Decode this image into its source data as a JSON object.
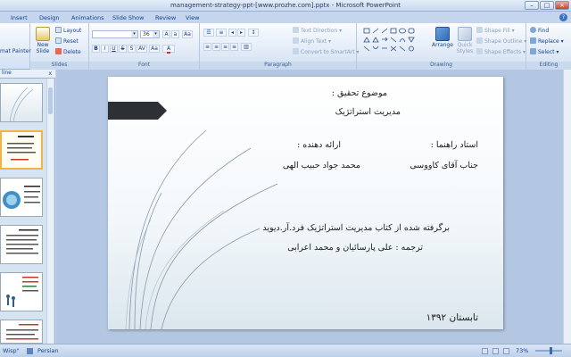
{
  "window": {
    "title": "management-strategy-ppt-[www.prozhe.com].pptx - Microsoft PowerPoint",
    "min": "–",
    "max": "□",
    "close": "×"
  },
  "tabs": [
    {
      "label": "Insert"
    },
    {
      "label": "Design"
    },
    {
      "label": "Animations"
    },
    {
      "label": "Slide Show"
    },
    {
      "label": "Review"
    },
    {
      "label": "View"
    }
  ],
  "ribbon": {
    "clipboard": {
      "paste_painter": "mat Painter"
    },
    "slides": {
      "label": "Slides",
      "new_slide": "New\nSlide",
      "layout": "Layout",
      "reset": "Reset",
      "delete": "Delete"
    },
    "font": {
      "label": "Font",
      "font_size": "36",
      "clear": "Aa"
    },
    "paragraph": {
      "label": "Paragraph",
      "text_direction": "Text Direction",
      "align_text": "Align Text",
      "convert_smartart": "Convert to SmartArt"
    },
    "drawing": {
      "label": "Drawing",
      "arrange": "Arrange",
      "quick_styles": "Quick\nStyles",
      "shape_fill": "Shape Fill",
      "shape_outline": "Shape Outline",
      "shape_effects": "Shape Effects"
    },
    "editing": {
      "label": "Editing",
      "find": "Find",
      "replace": "Replace",
      "select": "Select"
    }
  },
  "panel": {
    "tab": "line",
    "close": "x"
  },
  "slide": {
    "topic_label": "موضوع تحقیق :",
    "topic": "مدیریت استراتژیک",
    "advisor_label": "استاد راهنما :",
    "advisor": "جناب آقای کاووسی",
    "presenter_label": "ارائه دهنده :",
    "presenter": "محمد جواد حبیب الهی",
    "source": "برگرفته شده از کتاب مدیریت استراتژیک فرد.آر.دیوید",
    "translation": "ترجمه : علی پارسائیان و محمد اعرابی",
    "season": "تابستان ۱۳۹۲"
  },
  "status": {
    "theme": "Wisp\"",
    "language": "Persian",
    "zoom": "73%"
  },
  "colors": {
    "ribbon_text": "#15428b",
    "slide_arrow": "#2d3136"
  }
}
